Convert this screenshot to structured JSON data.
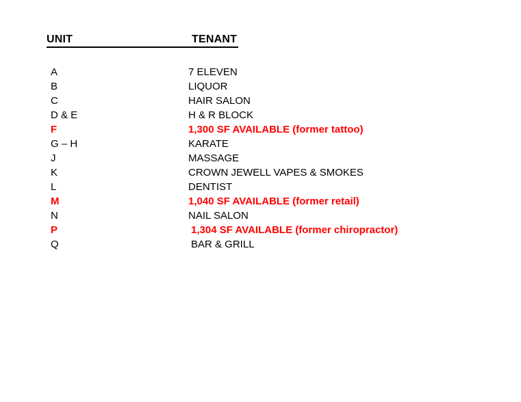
{
  "document": {
    "background_color": "#ffffff",
    "text_color": "#000000",
    "available_color": "#FF0000"
  },
  "table": {
    "header": {
      "unit_label": "UNIT",
      "tenant_label": "TENANT"
    },
    "rows": [
      {
        "unit": "A",
        "tenant": "7 ELEVEN",
        "available": false,
        "indented": false
      },
      {
        "unit": "B",
        "tenant": "LIQUOR",
        "available": false,
        "indented": false
      },
      {
        "unit": "C",
        "tenant": "HAIR SALON",
        "available": false,
        "indented": false
      },
      {
        "unit": "D & E",
        "tenant": "H & R BLOCK",
        "available": false,
        "indented": false
      },
      {
        "unit": "F",
        "tenant": "1,300 SF AVAILABLE (former tattoo)",
        "available": true,
        "indented": false
      },
      {
        "unit": "G – H",
        "tenant": "KARATE",
        "available": false,
        "indented": false
      },
      {
        "unit": "J",
        "tenant": "MASSAGE",
        "available": false,
        "indented": false
      },
      {
        "unit": "K",
        "tenant": "CROWN JEWELL VAPES & SMOKES",
        "available": false,
        "indented": false
      },
      {
        "unit": "L",
        "tenant": "DENTIST",
        "available": false,
        "indented": false
      },
      {
        "unit": "M",
        "tenant": "1,040 SF AVAILABLE (former retail)",
        "available": true,
        "indented": false
      },
      {
        "unit": "N",
        "tenant": "NAIL SALON",
        "available": false,
        "indented": false
      },
      {
        "unit": "P",
        "tenant": "1,304 SF AVAILABLE (former chiropractor)",
        "available": true,
        "indented": true
      },
      {
        "unit": "Q",
        "tenant": "BAR & GRILL",
        "available": false,
        "indented": true
      }
    ]
  }
}
